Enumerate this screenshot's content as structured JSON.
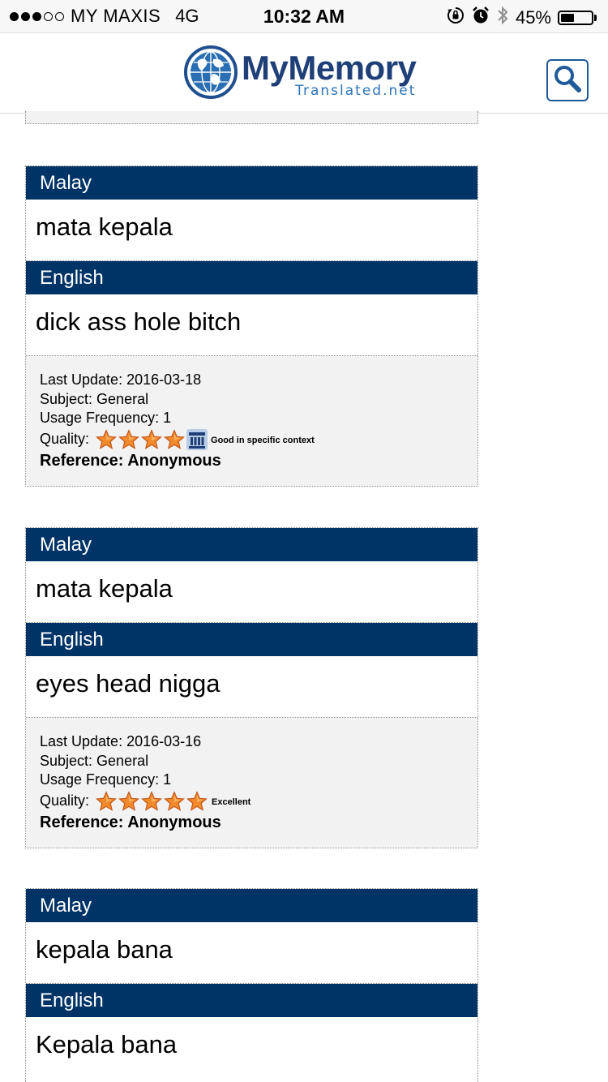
{
  "status_bar": {
    "signal_full": 3,
    "signal_total": 5,
    "carrier": "MY MAXIS",
    "network": "4G",
    "time": "10:32 AM",
    "battery": "45%",
    "battery_level": 0.45,
    "icons": [
      "rotation-lock-icon",
      "alarm-icon",
      "bluetooth-icon",
      "battery-icon"
    ]
  },
  "header": {
    "logo_title": "MyMemory",
    "logo_subtitle": "Translated.net",
    "search_icon": "search-icon"
  },
  "results": [
    {
      "source_lang": "Malay",
      "source_text": "mata kepala",
      "target_lang": "English",
      "target_text": "dick ass hole bitch",
      "last_update_label": "Last Update: 2016-03-18",
      "subject_label": "Subject: General",
      "usage_label": "Usage Frequency: 1",
      "quality_label": "Quality:",
      "quality_stars": 4,
      "quality_icon": "institution-icon",
      "quality_text": "Good in specific context",
      "reference_label": "Reference: Anonymous"
    },
    {
      "source_lang": "Malay",
      "source_text": "mata kepala",
      "target_lang": "English",
      "target_text": "eyes head nigga",
      "last_update_label": "Last Update: 2016-03-16",
      "subject_label": "Subject: General",
      "usage_label": "Usage Frequency: 1",
      "quality_label": "Quality:",
      "quality_stars": 5,
      "quality_text": "Excellent",
      "reference_label": "Reference: Anonymous"
    },
    {
      "source_lang": "Malay",
      "source_text": "kepala bana",
      "target_lang": "English",
      "target_text": "Kepala bana"
    }
  ],
  "colors": {
    "lang_bar": "#003366",
    "meta_bg": "#f2f2f2",
    "star_fill": "#f28a2b",
    "logo_blue": "#1f3f78"
  }
}
